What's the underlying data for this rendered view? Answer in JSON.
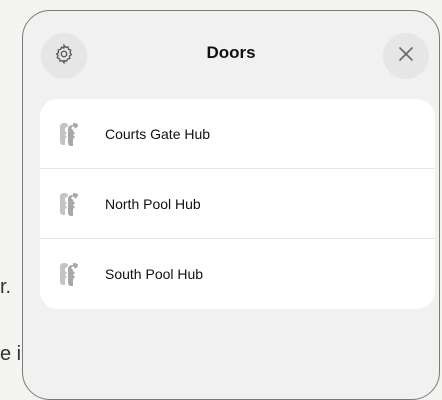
{
  "background": {
    "line1": "r.",
    "line2": "e i"
  },
  "modal": {
    "title": "Doors",
    "settings_icon": "gear-icon",
    "close_icon": "close-icon"
  },
  "doors": [
    {
      "label": "Courts Gate Hub",
      "icon": "keys-icon"
    },
    {
      "label": "North Pool Hub",
      "icon": "keys-icon"
    },
    {
      "label": "South Pool Hub",
      "icon": "keys-icon"
    }
  ],
  "colors": {
    "panel_bg": "#f1f1f1",
    "card_bg": "#ffffff",
    "icon_gray": "#b8b8b8"
  }
}
